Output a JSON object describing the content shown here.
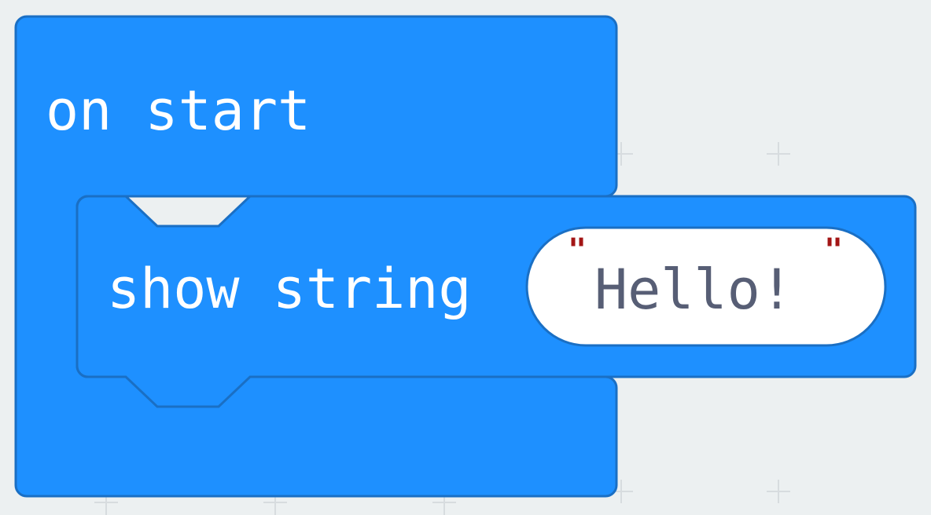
{
  "app": {
    "workspace": "blocks-workspace"
  },
  "on_start_block": {
    "label": "on start",
    "color": "#1e90ff",
    "border_color": "#1a6fc4"
  },
  "show_string_block": {
    "label": "show string",
    "color": "#1e90ff",
    "border_color": "#1a6fc4"
  },
  "string_input": {
    "value": "Hello!",
    "open_quote": "\"",
    "close_quote": "\"",
    "text_color": "#575e75",
    "quote_color": "#a31515"
  }
}
